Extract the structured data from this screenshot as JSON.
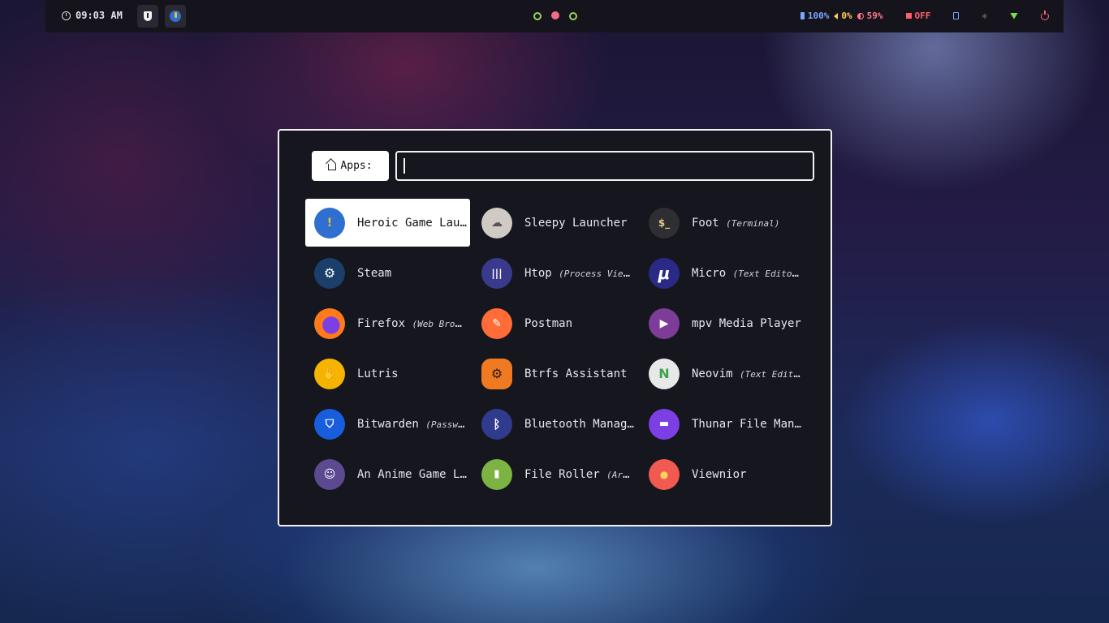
{
  "topbar": {
    "clock": "09:03 AM",
    "workspaces": [
      {
        "icon": "shield-icon"
      },
      {
        "icon": "heroic-icon"
      }
    ],
    "status": {
      "battery": "100%",
      "volume": "0%",
      "brightness": "59%",
      "recording": "OFF"
    },
    "colors": {
      "battery": "#7aa7ff",
      "volume": "#ffcc66",
      "brightness": "#ff7a8a",
      "recording": "#ff5f6d"
    }
  },
  "launcher": {
    "prompt": "Apps:",
    "search_value": "",
    "entries": [
      {
        "name": "Heroic Game Launcher",
        "comment": "",
        "selected": true
      },
      {
        "name": "Sleepy Launcher",
        "comment": ""
      },
      {
        "name": "Foot",
        "comment": "(Terminal)"
      },
      {
        "name": "Steam",
        "comment": ""
      },
      {
        "name": "Htop",
        "comment": "(Process Viewer)"
      },
      {
        "name": "Micro",
        "comment": "(Text Editor)"
      },
      {
        "name": "Firefox",
        "comment": "(Web Browser)"
      },
      {
        "name": "Postman",
        "comment": ""
      },
      {
        "name": "mpv Media Player",
        "comment": ""
      },
      {
        "name": "Lutris",
        "comment": ""
      },
      {
        "name": "Btrfs Assistant",
        "comment": ""
      },
      {
        "name": "Neovim",
        "comment": "(Text Editor)"
      },
      {
        "name": "Bitwarden",
        "comment": "(Password Manager)"
      },
      {
        "name": "Bluetooth Manager",
        "comment": ""
      },
      {
        "name": "Thunar File Manager",
        "comment": ""
      },
      {
        "name": "An Anime Game Launcher",
        "comment": ""
      },
      {
        "name": "File Roller",
        "comment": "(Archive Manager)"
      },
      {
        "name": "Viewnior",
        "comment": ""
      }
    ]
  }
}
